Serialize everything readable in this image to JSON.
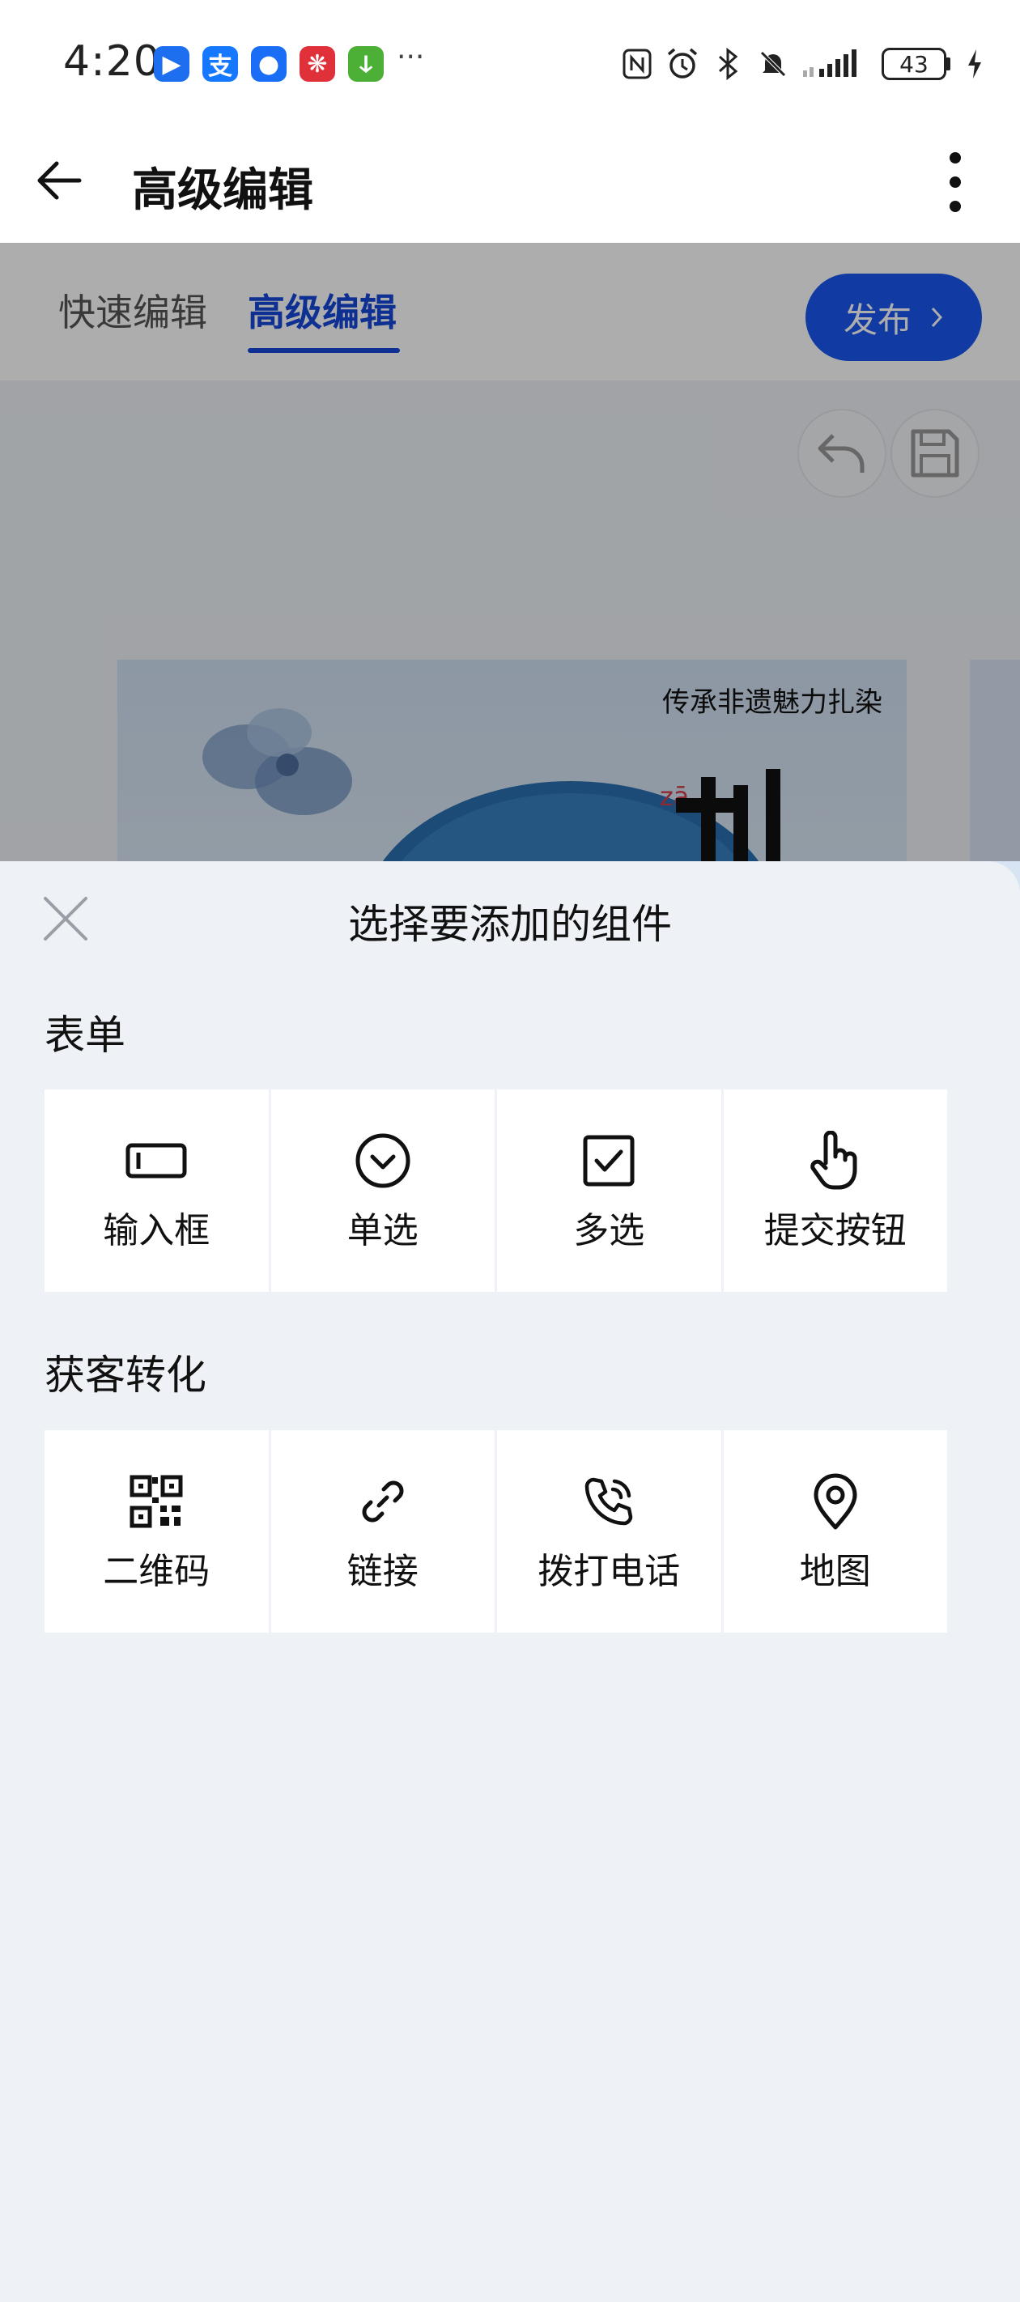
{
  "status_bar": {
    "time": "4:20",
    "app_icons": [
      {
        "icon": "bluebird-app-icon",
        "glyph": "▶",
        "color": "#1e6ff0"
      },
      {
        "icon": "alipay-app-icon",
        "glyph": "支",
        "color": "#1678ff"
      },
      {
        "icon": "robot-app-icon",
        "glyph": "●",
        "color": "#1a6ef5"
      },
      {
        "icon": "huawei-app-icon",
        "glyph": "❋",
        "color": "#e0303a"
      },
      {
        "icon": "wechat-app-icon",
        "glyph": "ↆ",
        "color": "#4caf36"
      }
    ],
    "more": "···",
    "battery": "43"
  },
  "header": {
    "title": "高级编辑"
  },
  "editor": {
    "tabs": [
      {
        "label": "快速编辑",
        "active": false
      },
      {
        "label": "高级编辑",
        "active": true
      }
    ],
    "publish_label": "发布",
    "poster": {
      "tagline": "传承非遗魅力扎染",
      "pinyin": "zā"
    }
  },
  "sheet": {
    "title": "选择要添加的组件",
    "sections": [
      {
        "title": "表单",
        "items": [
          {
            "label": "输入框",
            "icon": "input-field-icon"
          },
          {
            "label": "单选",
            "icon": "single-choice-icon"
          },
          {
            "label": "多选",
            "icon": "checkbox-icon"
          },
          {
            "label": "提交按钮",
            "icon": "hand-pointer-icon"
          }
        ]
      },
      {
        "title": "获客转化",
        "items": [
          {
            "label": "二维码",
            "icon": "qr-code-icon"
          },
          {
            "label": "链接",
            "icon": "link-icon"
          },
          {
            "label": "拨打电话",
            "icon": "phone-call-icon"
          },
          {
            "label": "地图",
            "icon": "map-pin-icon"
          }
        ]
      }
    ]
  },
  "colors": {
    "accent": "#1747d9",
    "publish": "#1a56f0",
    "sheet_bg": "#eef1f6"
  }
}
